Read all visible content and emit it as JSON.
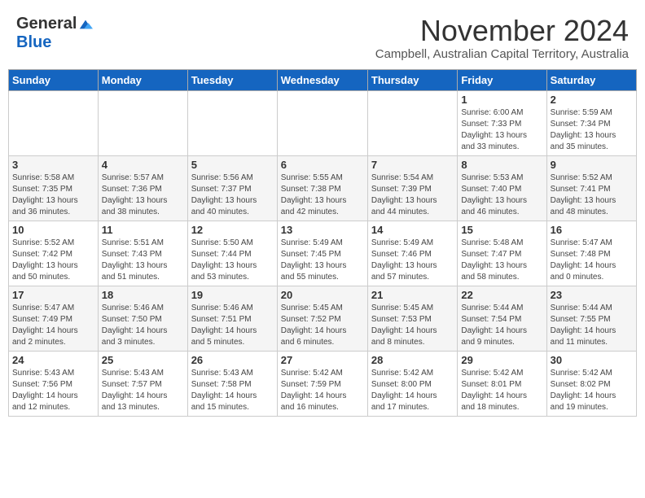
{
  "header": {
    "logo_general": "General",
    "logo_blue": "Blue",
    "month_title": "November 2024",
    "subtitle": "Campbell, Australian Capital Territory, Australia"
  },
  "weekdays": [
    "Sunday",
    "Monday",
    "Tuesday",
    "Wednesday",
    "Thursday",
    "Friday",
    "Saturday"
  ],
  "weeks": [
    [
      {
        "day": "",
        "detail": ""
      },
      {
        "day": "",
        "detail": ""
      },
      {
        "day": "",
        "detail": ""
      },
      {
        "day": "",
        "detail": ""
      },
      {
        "day": "",
        "detail": ""
      },
      {
        "day": "1",
        "detail": "Sunrise: 6:00 AM\nSunset: 7:33 PM\nDaylight: 13 hours\nand 33 minutes."
      },
      {
        "day": "2",
        "detail": "Sunrise: 5:59 AM\nSunset: 7:34 PM\nDaylight: 13 hours\nand 35 minutes."
      }
    ],
    [
      {
        "day": "3",
        "detail": "Sunrise: 5:58 AM\nSunset: 7:35 PM\nDaylight: 13 hours\nand 36 minutes."
      },
      {
        "day": "4",
        "detail": "Sunrise: 5:57 AM\nSunset: 7:36 PM\nDaylight: 13 hours\nand 38 minutes."
      },
      {
        "day": "5",
        "detail": "Sunrise: 5:56 AM\nSunset: 7:37 PM\nDaylight: 13 hours\nand 40 minutes."
      },
      {
        "day": "6",
        "detail": "Sunrise: 5:55 AM\nSunset: 7:38 PM\nDaylight: 13 hours\nand 42 minutes."
      },
      {
        "day": "7",
        "detail": "Sunrise: 5:54 AM\nSunset: 7:39 PM\nDaylight: 13 hours\nand 44 minutes."
      },
      {
        "day": "8",
        "detail": "Sunrise: 5:53 AM\nSunset: 7:40 PM\nDaylight: 13 hours\nand 46 minutes."
      },
      {
        "day": "9",
        "detail": "Sunrise: 5:52 AM\nSunset: 7:41 PM\nDaylight: 13 hours\nand 48 minutes."
      }
    ],
    [
      {
        "day": "10",
        "detail": "Sunrise: 5:52 AM\nSunset: 7:42 PM\nDaylight: 13 hours\nand 50 minutes."
      },
      {
        "day": "11",
        "detail": "Sunrise: 5:51 AM\nSunset: 7:43 PM\nDaylight: 13 hours\nand 51 minutes."
      },
      {
        "day": "12",
        "detail": "Sunrise: 5:50 AM\nSunset: 7:44 PM\nDaylight: 13 hours\nand 53 minutes."
      },
      {
        "day": "13",
        "detail": "Sunrise: 5:49 AM\nSunset: 7:45 PM\nDaylight: 13 hours\nand 55 minutes."
      },
      {
        "day": "14",
        "detail": "Sunrise: 5:49 AM\nSunset: 7:46 PM\nDaylight: 13 hours\nand 57 minutes."
      },
      {
        "day": "15",
        "detail": "Sunrise: 5:48 AM\nSunset: 7:47 PM\nDaylight: 13 hours\nand 58 minutes."
      },
      {
        "day": "16",
        "detail": "Sunrise: 5:47 AM\nSunset: 7:48 PM\nDaylight: 14 hours\nand 0 minutes."
      }
    ],
    [
      {
        "day": "17",
        "detail": "Sunrise: 5:47 AM\nSunset: 7:49 PM\nDaylight: 14 hours\nand 2 minutes."
      },
      {
        "day": "18",
        "detail": "Sunrise: 5:46 AM\nSunset: 7:50 PM\nDaylight: 14 hours\nand 3 minutes."
      },
      {
        "day": "19",
        "detail": "Sunrise: 5:46 AM\nSunset: 7:51 PM\nDaylight: 14 hours\nand 5 minutes."
      },
      {
        "day": "20",
        "detail": "Sunrise: 5:45 AM\nSunset: 7:52 PM\nDaylight: 14 hours\nand 6 minutes."
      },
      {
        "day": "21",
        "detail": "Sunrise: 5:45 AM\nSunset: 7:53 PM\nDaylight: 14 hours\nand 8 minutes."
      },
      {
        "day": "22",
        "detail": "Sunrise: 5:44 AM\nSunset: 7:54 PM\nDaylight: 14 hours\nand 9 minutes."
      },
      {
        "day": "23",
        "detail": "Sunrise: 5:44 AM\nSunset: 7:55 PM\nDaylight: 14 hours\nand 11 minutes."
      }
    ],
    [
      {
        "day": "24",
        "detail": "Sunrise: 5:43 AM\nSunset: 7:56 PM\nDaylight: 14 hours\nand 12 minutes."
      },
      {
        "day": "25",
        "detail": "Sunrise: 5:43 AM\nSunset: 7:57 PM\nDaylight: 14 hours\nand 13 minutes."
      },
      {
        "day": "26",
        "detail": "Sunrise: 5:43 AM\nSunset: 7:58 PM\nDaylight: 14 hours\nand 15 minutes."
      },
      {
        "day": "27",
        "detail": "Sunrise: 5:42 AM\nSunset: 7:59 PM\nDaylight: 14 hours\nand 16 minutes."
      },
      {
        "day": "28",
        "detail": "Sunrise: 5:42 AM\nSunset: 8:00 PM\nDaylight: 14 hours\nand 17 minutes."
      },
      {
        "day": "29",
        "detail": "Sunrise: 5:42 AM\nSunset: 8:01 PM\nDaylight: 14 hours\nand 18 minutes."
      },
      {
        "day": "30",
        "detail": "Sunrise: 5:42 AM\nSunset: 8:02 PM\nDaylight: 14 hours\nand 19 minutes."
      }
    ]
  ]
}
